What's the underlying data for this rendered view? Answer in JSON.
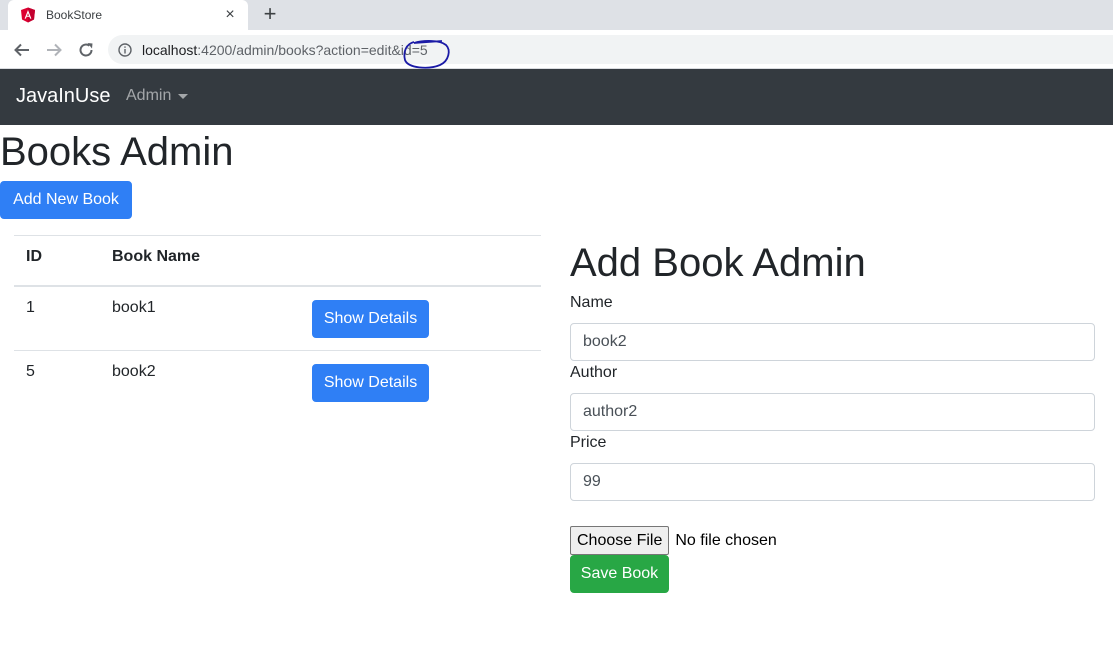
{
  "browser": {
    "tab_title": "BookStore",
    "tab_close": "×",
    "new_tab": "+",
    "url_host": "localhost",
    "url_rest": ":4200/admin/books?action=edit&id=5"
  },
  "navbar": {
    "brand": "JavaInUse",
    "menu_label": "Admin"
  },
  "page": {
    "title": "Books Admin",
    "add_button": "Add New Book"
  },
  "table": {
    "headers": [
      "ID",
      "Book Name",
      ""
    ],
    "rows": [
      {
        "id": "1",
        "name": "book1",
        "action": "Show Details"
      },
      {
        "id": "5",
        "name": "book2",
        "action": "Show Details"
      }
    ]
  },
  "form": {
    "title": "Add Book Admin",
    "name_label": "Name",
    "name_value": "book2",
    "author_label": "Author",
    "author_value": "author2",
    "price_label": "Price",
    "price_value": "99",
    "file_button": "Choose File",
    "file_status": "No file chosen",
    "save_button": "Save Book"
  },
  "colors": {
    "navbar_bg": "#343a40",
    "primary": "#2f7ff5",
    "success": "#28a745",
    "annotation": "#1a1aa6"
  },
  "icons": {
    "favicon": "angular-logo-icon",
    "back": "arrow-left-icon",
    "forward": "arrow-right-icon",
    "reload": "reload-icon",
    "site_info": "info-icon",
    "dropdown": "caret-down-icon"
  }
}
